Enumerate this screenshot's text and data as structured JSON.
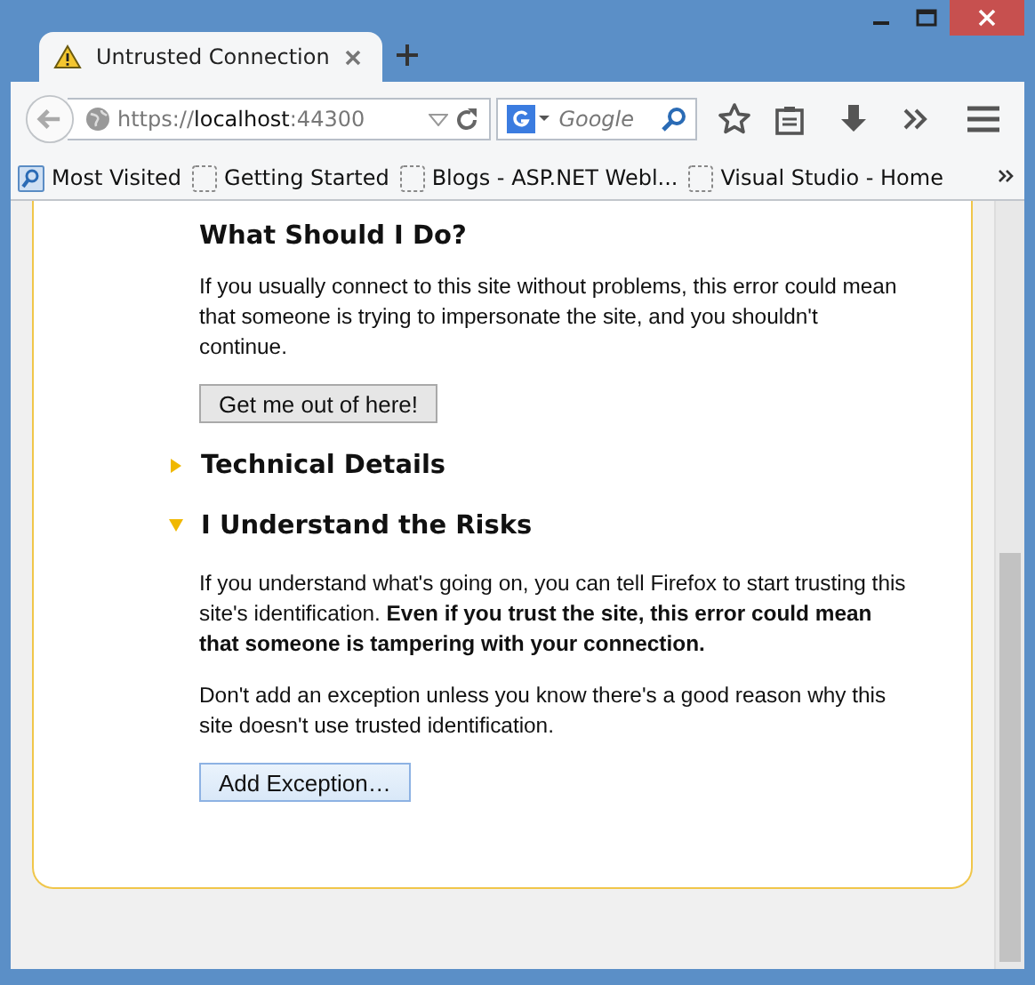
{
  "tabs": [
    {
      "label": "Untrusted Connection",
      "selected": true
    }
  ],
  "address_bar": {
    "scheme": "https://",
    "host": "localhost",
    "port": ":44300"
  },
  "search": {
    "placeholder": "Google"
  },
  "bookmarks": [
    {
      "label": "Most Visited",
      "kind": "smart"
    },
    {
      "label": "Getting Started",
      "kind": "page"
    },
    {
      "label": "Blogs - ASP.NET Webl...",
      "kind": "page"
    },
    {
      "label": "Visual Studio - Home",
      "kind": "page"
    }
  ],
  "page": {
    "heading": "What Should I Do?",
    "intro": "If you usually connect to this site without problems, this error could mean that someone is trying to impersonate the site, and you shouldn't continue.",
    "escape_button": "Get me out of here!",
    "sections": [
      {
        "label": "Technical Details",
        "expanded": false
      },
      {
        "label": "I Understand the Risks",
        "expanded": true
      }
    ],
    "risk_paragraphs": [
      "If you understand what's going on, you can tell Firefox to start trusting this site's identification. **Even if you trust the site, this error could mean that someone is tampering with your connection.**",
      "Don't add an exception unless you know there's a good reason why this site doesn't use trusted identification."
    ],
    "exception_button": "Add Exception…"
  }
}
